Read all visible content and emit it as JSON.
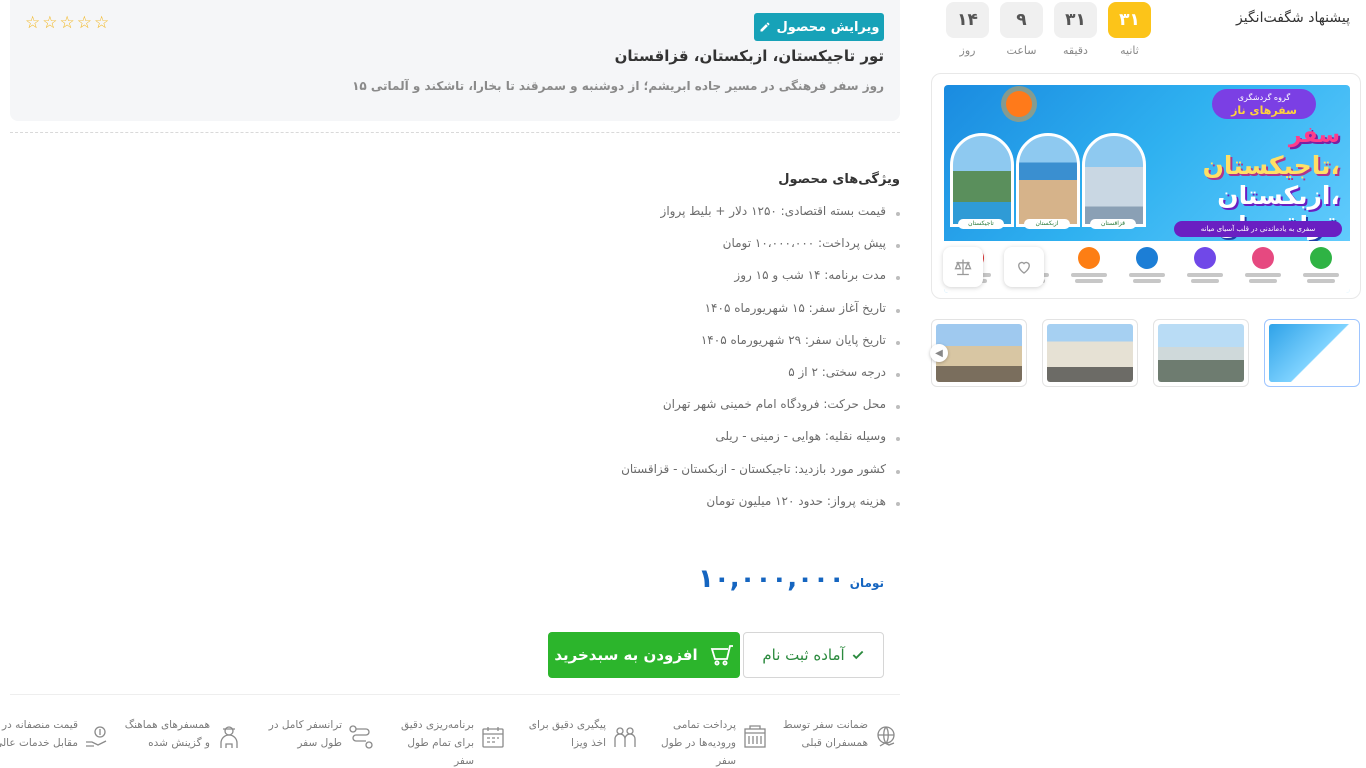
{
  "offer": {
    "title": "پیشنهاد شگفت‌انگیز",
    "countdown": [
      {
        "value": "۳۱",
        "label": "ثانیه"
      },
      {
        "value": "۳۱",
        "label": "دقیقه"
      },
      {
        "value": "۹",
        "label": "ساعت"
      },
      {
        "value": "۱۴",
        "label": "روز"
      }
    ]
  },
  "gallery": {
    "banner": {
      "badge_small": "گروه گردشگری",
      "badge_big": "سفرهای ناز",
      "line1": "سفر",
      "line2": "تاجیکستان،",
      "line3": "ازبکستان،",
      "line4": "قزاقستان",
      "ribbon": "سفری به یادماندنی در قلب آسیای میانه",
      "tags": [
        "تاجیکستان",
        "ازبکستان",
        "قزاقستان"
      ],
      "feature_colors": [
        "#2fb344",
        "#e64980",
        "#7048e8",
        "#1c7ed6",
        "#fd7e14",
        "#37b24d",
        "#e03131"
      ]
    },
    "thumbnails": 4
  },
  "product": {
    "edit_label": "ویرایش محصول",
    "title": "تور تاجیکستان، ازبکستان، قزاقستان",
    "subtitle": "۱۵ روز سفر فرهنگی در مسیر جاده ابریشم؛ از دوشنبه و سمرقند تا بخارا، تاشکند و آلماتی",
    "rating": 0,
    "stars": "☆☆☆☆☆"
  },
  "features": {
    "title": "ویژگی‌های محصول",
    "items": [
      "قیمت بسته اقتصادی: ۱۲۵۰ دلار + بلیط پرواز",
      "پیش پرداخت: ۱۰،۰۰۰،۰۰۰ تومان",
      "مدت برنامه: ۱۴ شب و ۱۵ روز",
      "تاریخ آغاز سفر: ۱۵ شهریورماه ۱۴۰۵",
      "تاریخ پایان سفر: ۲۹ شهریورماه ۱۴۰۵",
      "درجه سختی: ۲ از ۵",
      "محل حرکت: فرودگاه امام خمینی شهر تهران",
      "وسیله نقلیه: هوایی - زمینی - ریلی",
      "کشور مورد بازدید: تاجیکستان - ازبکستان - قزاقستان",
      "هزینه پرواز: حدود ۱۲۰ میلیون تومان"
    ]
  },
  "price": {
    "amount": "۱۰,۰۰۰,۰۰۰",
    "currency": "تومان"
  },
  "actions": {
    "add_to_cart": "افزودن به سبدخرید",
    "ready_register": "آماده ثبت نام"
  },
  "services": [
    {
      "icon": "handshake-globe-icon",
      "text": "ضمانت سفر توسط همسفران قبلی"
    },
    {
      "icon": "building-icon",
      "text": "پرداخت تمامی ورودیه‌ها در طول سفر"
    },
    {
      "icon": "passport-icon",
      "text": "پیگیری دقیق برای اخذ ویزا"
    },
    {
      "icon": "calendar-icon",
      "text": "برنامه‌ریزی دقیق برای تمام طول سفر"
    },
    {
      "icon": "route-icon",
      "text": "ترانسفر کامل در طول سفر"
    },
    {
      "icon": "traveler-icon",
      "text": "همسفرهای هماهنگ و گزینش شده"
    },
    {
      "icon": "price-hand-icon",
      "text": "قیمت منصفانه در مقابل خدمات عالی"
    }
  ]
}
